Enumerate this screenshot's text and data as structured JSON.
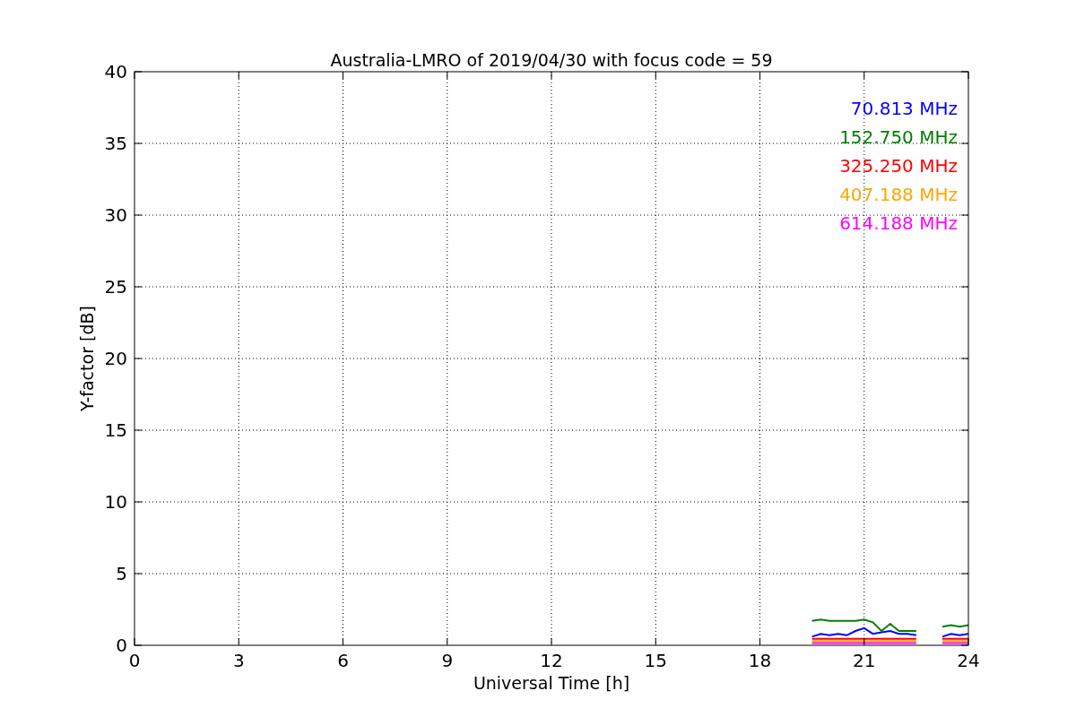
{
  "chart_data": {
    "type": "line",
    "title": "Australia-LMRO of 2019/04/30 with focus code = 59",
    "xlabel": "Universal Time [h]",
    "ylabel": "Y-factor [dB]",
    "x": [
      19.5,
      19.75,
      20,
      20.25,
      20.5,
      20.75,
      21,
      21.25,
      21.5,
      21.75,
      22,
      22.25,
      22.5,
      22.75,
      23,
      23.25,
      23.5,
      23.75,
      24
    ],
    "series": [
      {
        "name": "70.813 MHz",
        "color": "#0000ff",
        "values": [
          0.6,
          0.8,
          0.7,
          0.8,
          0.7,
          1.0,
          1.2,
          0.8,
          0.9,
          1.0,
          0.8,
          0.8,
          0.7,
          null,
          null,
          0.6,
          0.8,
          0.7,
          0.8
        ]
      },
      {
        "name": "152.750 MHz",
        "color": "#008000",
        "values": [
          1.7,
          1.8,
          1.7,
          1.7,
          1.7,
          1.7,
          1.8,
          1.6,
          1.0,
          1.5,
          1.0,
          1.0,
          1.0,
          null,
          null,
          1.3,
          1.4,
          1.3,
          1.4
        ]
      },
      {
        "name": "325.250 MHz",
        "color": "#ff0000",
        "values": [
          0.45,
          0.45,
          0.45,
          0.45,
          0.45,
          0.45,
          0.45,
          0.45,
          0.45,
          0.45,
          0.45,
          0.45,
          0.45,
          null,
          null,
          0.45,
          0.45,
          0.45,
          0.45
        ]
      },
      {
        "name": "407.188 MHz",
        "color": "#ffa500",
        "values": [
          0.3,
          0.3,
          0.3,
          0.3,
          0.3,
          0.3,
          0.3,
          0.3,
          0.3,
          0.3,
          0.3,
          0.3,
          0.3,
          null,
          null,
          0.3,
          0.3,
          0.3,
          0.3
        ]
      },
      {
        "name": "614.188 MHz",
        "color": "#ff00ff",
        "values": [
          0.15,
          0.15,
          0.15,
          0.15,
          0.15,
          0.15,
          0.15,
          0.15,
          0.15,
          0.15,
          0.15,
          0.15,
          0.15,
          null,
          null,
          0.15,
          0.15,
          0.15,
          0.15
        ]
      }
    ],
    "grid": true,
    "xlim": [
      0,
      24
    ],
    "ylim": [
      0,
      40
    ],
    "xticks": [
      0,
      3,
      6,
      9,
      12,
      15,
      18,
      21,
      24
    ],
    "yticks": [
      0,
      5,
      10,
      15,
      20,
      25,
      30,
      35,
      40
    ]
  }
}
